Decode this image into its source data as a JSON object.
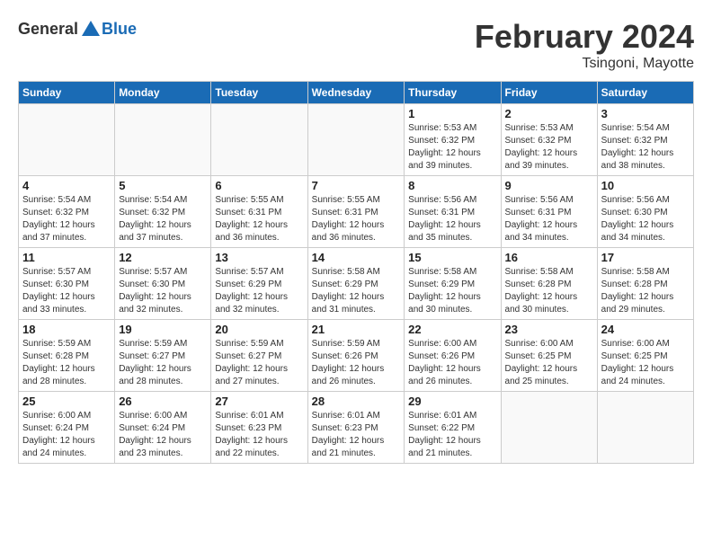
{
  "header": {
    "logo_general": "General",
    "logo_blue": "Blue",
    "month_title": "February 2024",
    "location": "Tsingoni, Mayotte"
  },
  "days_of_week": [
    "Sunday",
    "Monday",
    "Tuesday",
    "Wednesday",
    "Thursday",
    "Friday",
    "Saturday"
  ],
  "weeks": [
    [
      {
        "day": "",
        "info": ""
      },
      {
        "day": "",
        "info": ""
      },
      {
        "day": "",
        "info": ""
      },
      {
        "day": "",
        "info": ""
      },
      {
        "day": "1",
        "info": "Sunrise: 5:53 AM\nSunset: 6:32 PM\nDaylight: 12 hours\nand 39 minutes."
      },
      {
        "day": "2",
        "info": "Sunrise: 5:53 AM\nSunset: 6:32 PM\nDaylight: 12 hours\nand 39 minutes."
      },
      {
        "day": "3",
        "info": "Sunrise: 5:54 AM\nSunset: 6:32 PM\nDaylight: 12 hours\nand 38 minutes."
      }
    ],
    [
      {
        "day": "4",
        "info": "Sunrise: 5:54 AM\nSunset: 6:32 PM\nDaylight: 12 hours\nand 37 minutes."
      },
      {
        "day": "5",
        "info": "Sunrise: 5:54 AM\nSunset: 6:32 PM\nDaylight: 12 hours\nand 37 minutes."
      },
      {
        "day": "6",
        "info": "Sunrise: 5:55 AM\nSunset: 6:31 PM\nDaylight: 12 hours\nand 36 minutes."
      },
      {
        "day": "7",
        "info": "Sunrise: 5:55 AM\nSunset: 6:31 PM\nDaylight: 12 hours\nand 36 minutes."
      },
      {
        "day": "8",
        "info": "Sunrise: 5:56 AM\nSunset: 6:31 PM\nDaylight: 12 hours\nand 35 minutes."
      },
      {
        "day": "9",
        "info": "Sunrise: 5:56 AM\nSunset: 6:31 PM\nDaylight: 12 hours\nand 34 minutes."
      },
      {
        "day": "10",
        "info": "Sunrise: 5:56 AM\nSunset: 6:30 PM\nDaylight: 12 hours\nand 34 minutes."
      }
    ],
    [
      {
        "day": "11",
        "info": "Sunrise: 5:57 AM\nSunset: 6:30 PM\nDaylight: 12 hours\nand 33 minutes."
      },
      {
        "day": "12",
        "info": "Sunrise: 5:57 AM\nSunset: 6:30 PM\nDaylight: 12 hours\nand 32 minutes."
      },
      {
        "day": "13",
        "info": "Sunrise: 5:57 AM\nSunset: 6:29 PM\nDaylight: 12 hours\nand 32 minutes."
      },
      {
        "day": "14",
        "info": "Sunrise: 5:58 AM\nSunset: 6:29 PM\nDaylight: 12 hours\nand 31 minutes."
      },
      {
        "day": "15",
        "info": "Sunrise: 5:58 AM\nSunset: 6:29 PM\nDaylight: 12 hours\nand 30 minutes."
      },
      {
        "day": "16",
        "info": "Sunrise: 5:58 AM\nSunset: 6:28 PM\nDaylight: 12 hours\nand 30 minutes."
      },
      {
        "day": "17",
        "info": "Sunrise: 5:58 AM\nSunset: 6:28 PM\nDaylight: 12 hours\nand 29 minutes."
      }
    ],
    [
      {
        "day": "18",
        "info": "Sunrise: 5:59 AM\nSunset: 6:28 PM\nDaylight: 12 hours\nand 28 minutes."
      },
      {
        "day": "19",
        "info": "Sunrise: 5:59 AM\nSunset: 6:27 PM\nDaylight: 12 hours\nand 28 minutes."
      },
      {
        "day": "20",
        "info": "Sunrise: 5:59 AM\nSunset: 6:27 PM\nDaylight: 12 hours\nand 27 minutes."
      },
      {
        "day": "21",
        "info": "Sunrise: 5:59 AM\nSunset: 6:26 PM\nDaylight: 12 hours\nand 26 minutes."
      },
      {
        "day": "22",
        "info": "Sunrise: 6:00 AM\nSunset: 6:26 PM\nDaylight: 12 hours\nand 26 minutes."
      },
      {
        "day": "23",
        "info": "Sunrise: 6:00 AM\nSunset: 6:25 PM\nDaylight: 12 hours\nand 25 minutes."
      },
      {
        "day": "24",
        "info": "Sunrise: 6:00 AM\nSunset: 6:25 PM\nDaylight: 12 hours\nand 24 minutes."
      }
    ],
    [
      {
        "day": "25",
        "info": "Sunrise: 6:00 AM\nSunset: 6:24 PM\nDaylight: 12 hours\nand 24 minutes."
      },
      {
        "day": "26",
        "info": "Sunrise: 6:00 AM\nSunset: 6:24 PM\nDaylight: 12 hours\nand 23 minutes."
      },
      {
        "day": "27",
        "info": "Sunrise: 6:01 AM\nSunset: 6:23 PM\nDaylight: 12 hours\nand 22 minutes."
      },
      {
        "day": "28",
        "info": "Sunrise: 6:01 AM\nSunset: 6:23 PM\nDaylight: 12 hours\nand 21 minutes."
      },
      {
        "day": "29",
        "info": "Sunrise: 6:01 AM\nSunset: 6:22 PM\nDaylight: 12 hours\nand 21 minutes."
      },
      {
        "day": "",
        "info": ""
      },
      {
        "day": "",
        "info": ""
      }
    ]
  ]
}
